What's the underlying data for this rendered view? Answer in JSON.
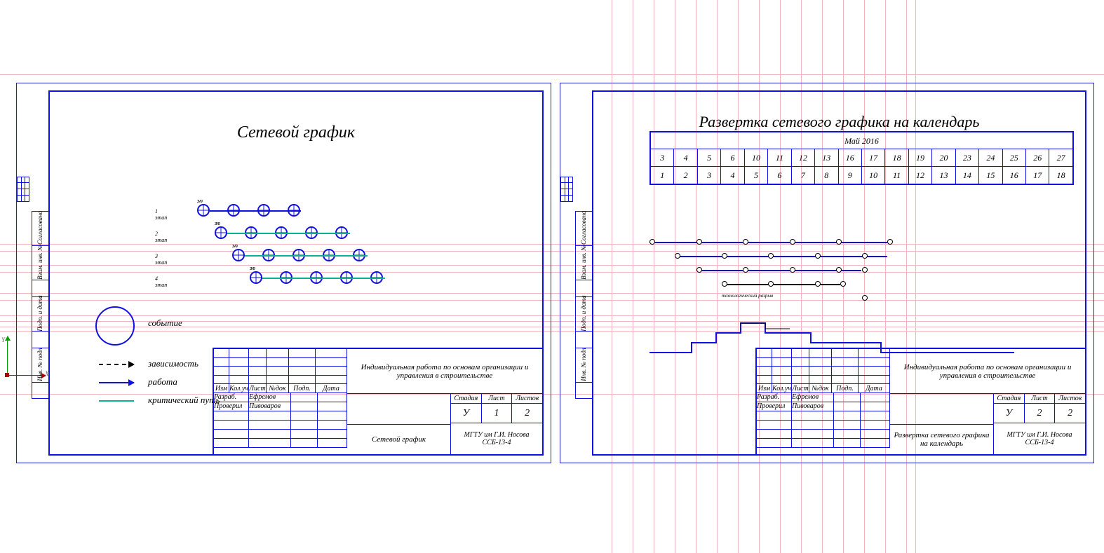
{
  "sheet1": {
    "title": "Сетевой график",
    "legend": {
      "event": "событие",
      "dependency": "зависимость",
      "work": "работа",
      "critical": "критический путь"
    },
    "rows": [
      {
        "label": "1 этап",
        "nodes": 4,
        "offset": 0
      },
      {
        "label": "2 этап",
        "nodes": 5,
        "offset": 25
      },
      {
        "label": "3 этап",
        "nodes": 5,
        "offset": 50
      },
      {
        "label": "4 этап",
        "nodes": 5,
        "offset": 75
      }
    ]
  },
  "sheet2": {
    "title": "Развертка сетевого графика на календарь",
    "month": "Май 2016",
    "days": [
      "3",
      "4",
      "5",
      "6",
      "10",
      "11",
      "12",
      "13",
      "16",
      "17",
      "18",
      "19",
      "20",
      "23",
      "24",
      "25",
      "26",
      "27"
    ],
    "steps": [
      "1",
      "2",
      "3",
      "4",
      "5",
      "6",
      "7",
      "8",
      "9",
      "10",
      "11",
      "12",
      "13",
      "14",
      "15",
      "16",
      "17",
      "18"
    ]
  },
  "stamp": {
    "cols": [
      "Изм",
      "Кол.уч",
      "Лист",
      "№док",
      "Подп.",
      "Дата"
    ],
    "roles": [
      {
        "role": "Разраб.",
        "name": "Ефремов"
      },
      {
        "role": "Проверил",
        "name": "Пивоваров"
      }
    ],
    "project": "Индивидуальная работа по основам организации и управления в строительстве",
    "subtitle1": "Сетевой график",
    "subtitle2": "Развертка сетевого графика на календарь",
    "sl": {
      "stage": "Стадия",
      "sheet": "Лист",
      "sheets": "Листов"
    },
    "v1": {
      "stage": "У",
      "sheet": "1",
      "sheets": "2"
    },
    "v2": {
      "stage": "У",
      "sheet": "2",
      "sheets": "2"
    },
    "org1": "МГТУ им Г.И. Носова",
    "org2": "ССБ‑13‑4"
  },
  "side": [
    "Согласовано",
    "Взам. инв. №",
    "Подп. и дата",
    "Инв. № подл"
  ],
  "axes": {
    "x": "X",
    "y": "Y"
  }
}
